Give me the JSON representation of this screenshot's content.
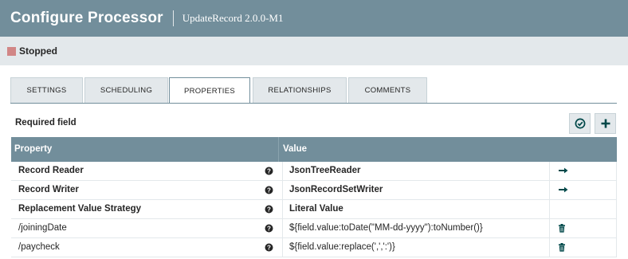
{
  "header": {
    "title": "Configure Processor",
    "subtitle": "UpdateRecord 2.0.0-M1"
  },
  "status": {
    "label": "Stopped",
    "color": "#d18686"
  },
  "tabs": [
    {
      "label": "SETTINGS",
      "active": false
    },
    {
      "label": "SCHEDULING",
      "active": false
    },
    {
      "label": "PROPERTIES",
      "active": true
    },
    {
      "label": "RELATIONSHIPS",
      "active": false
    },
    {
      "label": "COMMENTS",
      "active": false
    }
  ],
  "required_label": "Required field",
  "toolbar": {
    "verify_icon": "check-circle-icon",
    "add_icon": "plus-icon"
  },
  "table": {
    "columns": [
      "Property",
      "Value"
    ],
    "rows": [
      {
        "property": "Record Reader",
        "required": true,
        "value": "JsonTreeReader",
        "value_bold": true,
        "action": "arrow-right-icon"
      },
      {
        "property": "Record Writer",
        "required": true,
        "value": "JsonRecordSetWriter",
        "value_bold": true,
        "action": "arrow-right-icon"
      },
      {
        "property": "Replacement Value Strategy",
        "required": true,
        "value": "Literal Value",
        "value_bold": true,
        "action": ""
      },
      {
        "property": "/joiningDate",
        "required": false,
        "value": "${field.value:toDate(\"MM-dd-yyyy\"):toNumber()}",
        "value_bold": false,
        "action": "trash-icon"
      },
      {
        "property": "/paycheck",
        "required": false,
        "value": "${field.value:replace(',',':')}",
        "value_bold": false,
        "action": "trash-icon"
      }
    ]
  },
  "colors": {
    "header": "#728e9b",
    "band": "#e3e8eb",
    "text": "#262626",
    "icon": "#004849"
  }
}
